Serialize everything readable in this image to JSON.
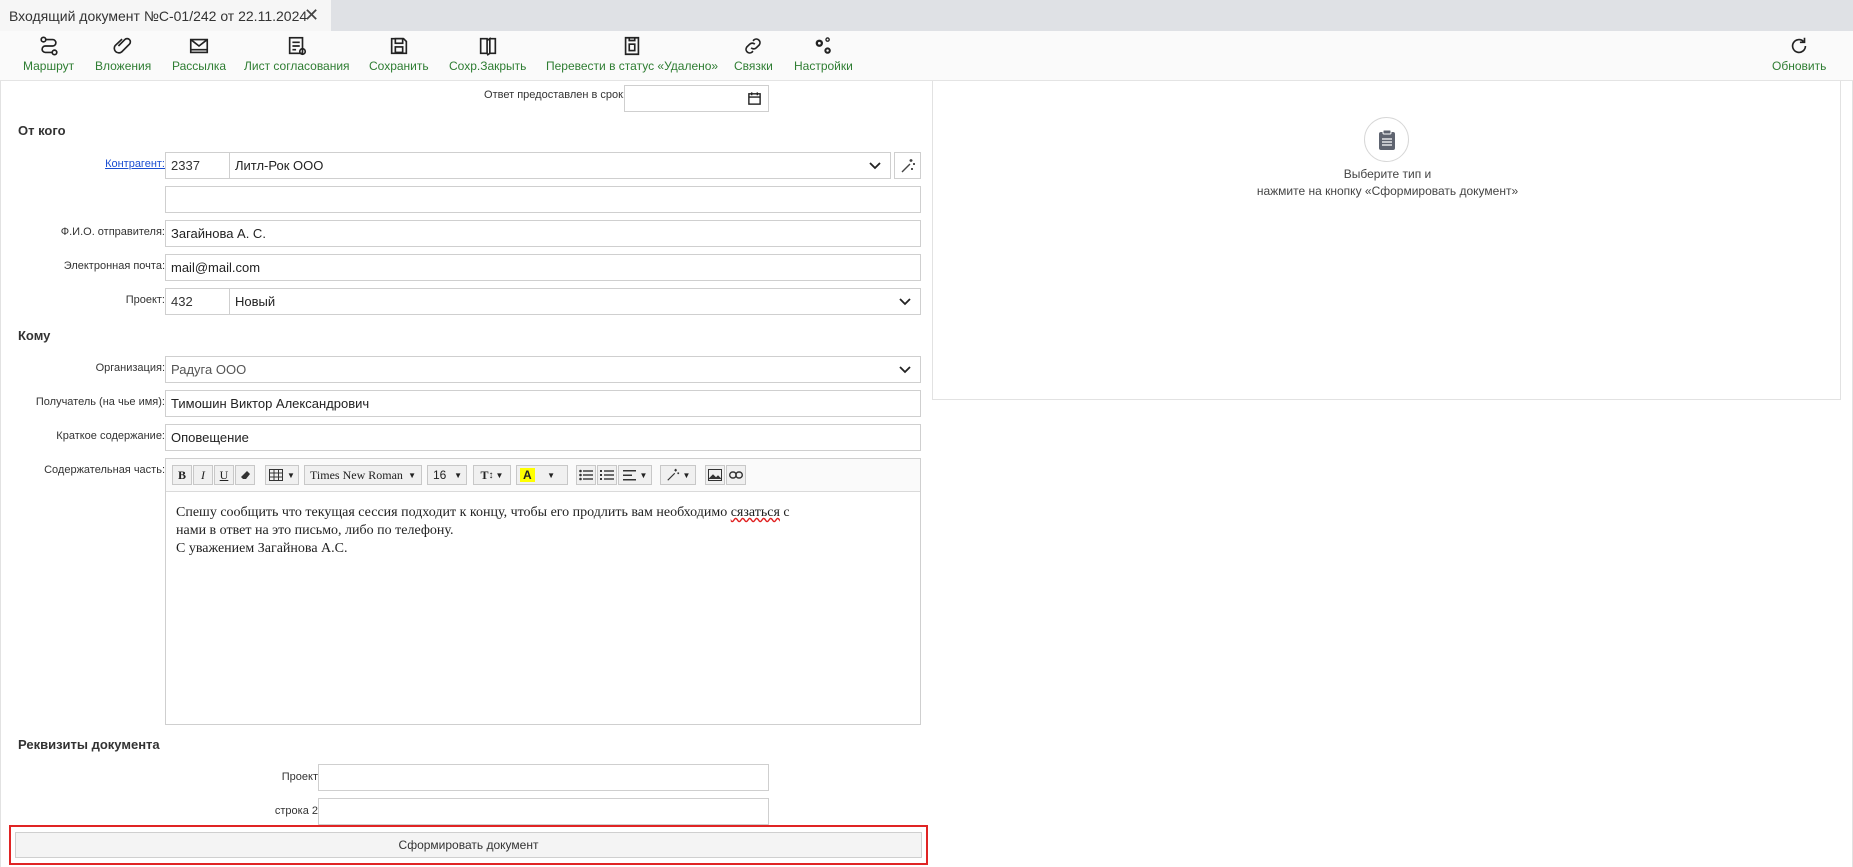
{
  "tab": {
    "title": "Входящий документ №С-01/242 от 22.11.2024"
  },
  "toolbar": {
    "route": "Маршрут",
    "attachments": "Вложения",
    "mailing": "Рассылка",
    "approval_sheet": "Лист согласования",
    "save": "Сохранить",
    "save_close": "Сохр.Закрыть",
    "set_deleted": "Перевести в статус «Удалено»",
    "links": "Связки",
    "settings": "Настройки",
    "refresh": "Обновить"
  },
  "form": {
    "reply_label": "Ответ предоставлен в срок:",
    "reply_value": "",
    "from_section": "От кого",
    "counterparty_label": "Контрагент:",
    "counterparty_code": "2337",
    "counterparty_name": "Литл-Рок ООО",
    "extra_value": "",
    "sender_label": "Ф.И.О. отправителя:",
    "sender_value": "Загайнова А. С.",
    "email_label": "Электронная почта:",
    "email_value": "mail@mail.com",
    "project_label": "Проект:",
    "project_code": "432",
    "project_name": "Новый",
    "to_section": "Кому",
    "org_label": "Организация:",
    "org_value": "Радуга ООО",
    "recipient_label": "Получатель (на чье имя):",
    "recipient_value": "Тимошин Виктор Александрович",
    "summary_label": "Краткое содержание:",
    "summary_value": "Оповещение",
    "content_label": "Содержательная часть:"
  },
  "editor": {
    "bold": "B",
    "italic": "I",
    "underline": "U",
    "font_family": "Times New Roman",
    "font_size": "16",
    "line1_a": "Спешу сообщить что текущая сессия подходит к концу, чтобы его продлить вам необходимо ",
    "line1_b": "сязаться",
    "line1_c": " с",
    "line2": "нами в ответ на это письмо, либо по телефону.",
    "line3": "С уважением Загайнова А.С."
  },
  "requisites": {
    "section": "Реквизиты документа",
    "project_label": "Проект",
    "project_value": "",
    "row2_label": "строка 2",
    "row2_value": ""
  },
  "preview": {
    "line1": "Выберите тип и",
    "line2": "нажмите на кнопку «Сформировать документ»"
  },
  "generate_button": "Сформировать документ"
}
